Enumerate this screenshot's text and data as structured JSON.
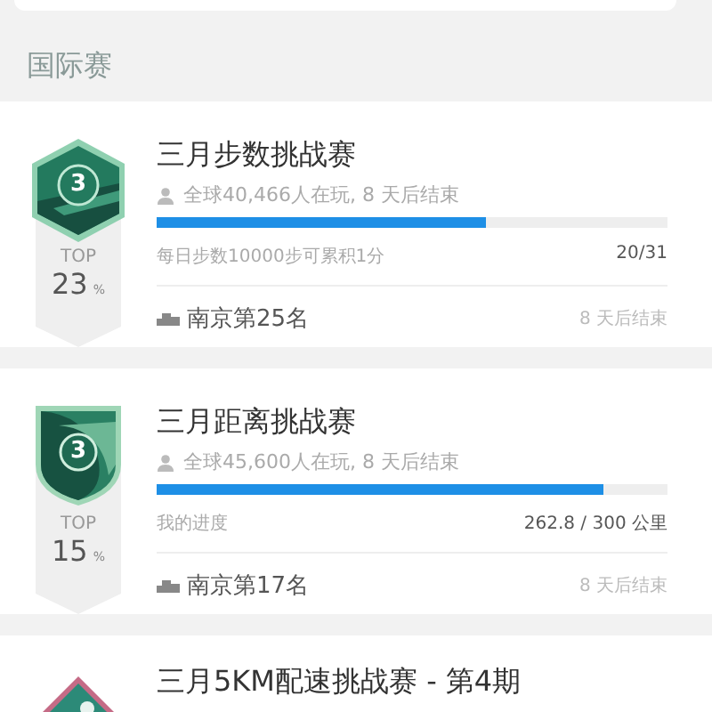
{
  "section_title": "国际赛",
  "challenges": [
    {
      "badge": {
        "kind": "hexagon",
        "rank": "3",
        "top_label": "TOP",
        "percent": "23",
        "percent_unit": "%"
      },
      "title": "三月步数挑战赛",
      "players": "全球40,466人在玩, 8 天后结束",
      "level": 0.645,
      "progress_label": "每日步数10000步可累积1分",
      "progress_value": "20/31",
      "city_rank": "南京第25名",
      "ends": "8 天后结束"
    },
    {
      "badge": {
        "kind": "shield",
        "rank": "3",
        "top_label": "TOP",
        "percent": "15",
        "percent_unit": "%"
      },
      "title": "三月距离挑战赛",
      "players": "全球45,600人在玩, 8 天后结束",
      "level": 0.876,
      "progress_label": "我的进度",
      "progress_value": "262.8 / 300 公里",
      "city_rank": "南京第17名",
      "ends": "8 天后结束"
    },
    {
      "badge": {
        "kind": "diamond"
      },
      "title": "三月5KM配速挑战赛 - 第4期"
    }
  ]
}
